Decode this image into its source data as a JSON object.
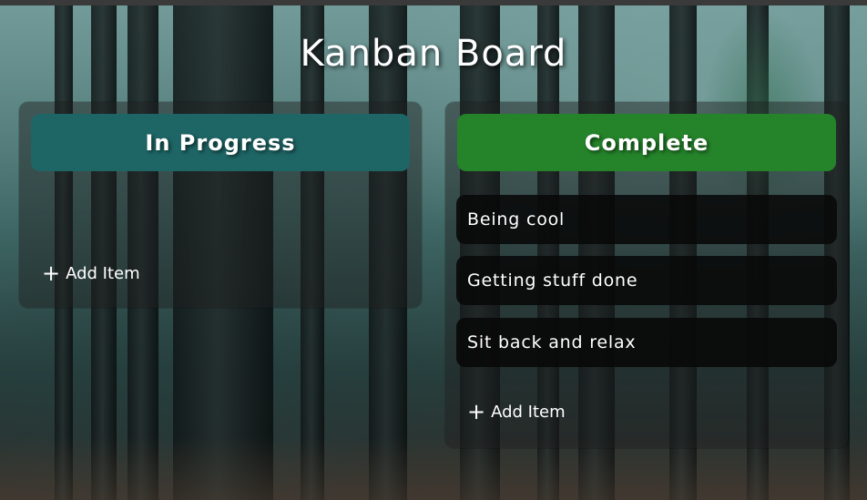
{
  "board": {
    "title": "Kanban Board"
  },
  "columns": [
    {
      "title": "In Progress",
      "color": "#1e6666",
      "items": [],
      "add_label": "Add Item"
    },
    {
      "title": "Complete",
      "color": "#25842a",
      "items": [
        "Being cool",
        "Getting stuff done",
        "Sit back and relax"
      ],
      "add_label": "Add Item"
    }
  ],
  "icons": {
    "add": "plus-icon"
  }
}
